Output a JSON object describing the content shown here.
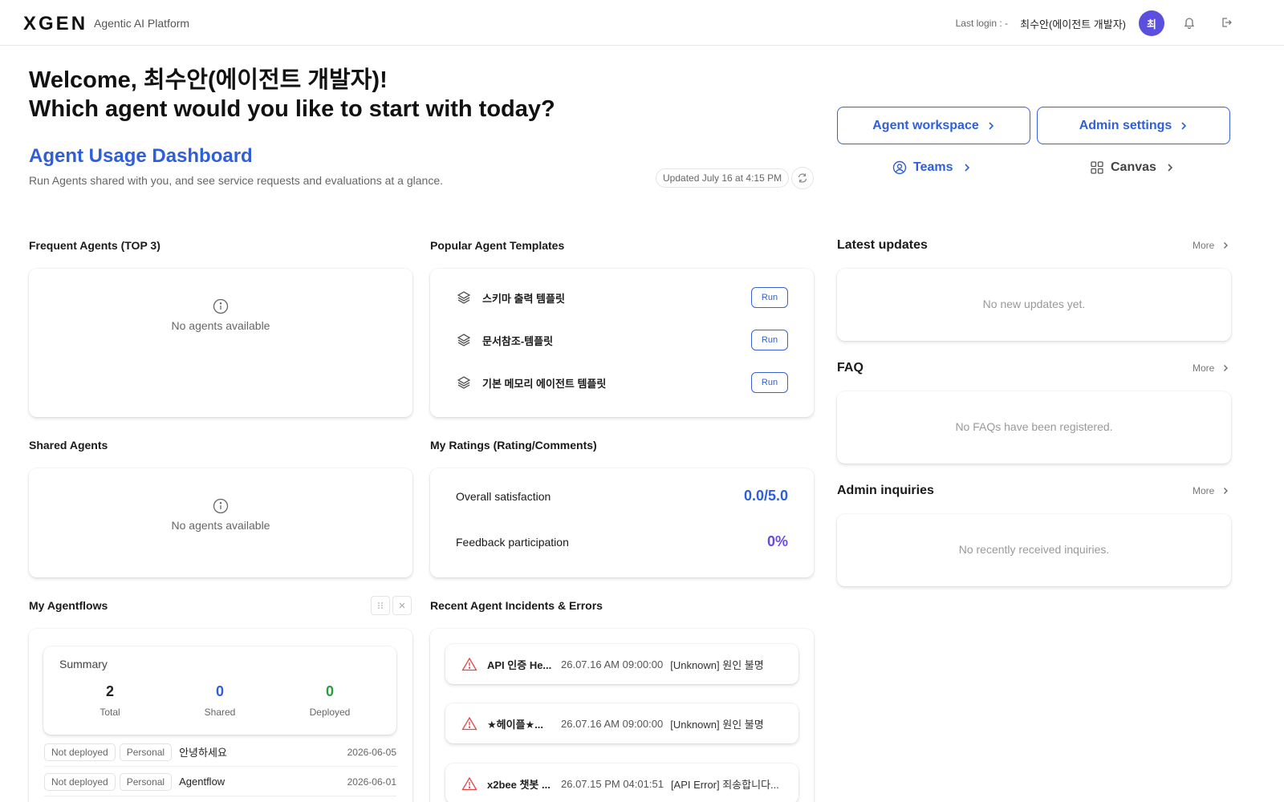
{
  "header": {
    "logo": "GEN",
    "logo_mark": "X",
    "platform": "Agentic AI Platform",
    "last_login": "Last login : -",
    "username": "최수안(에이전트 개발자)",
    "avatar": "최"
  },
  "welcome": {
    "line1": "Welcome, 최수안(에이전트 개발자)!",
    "line2": "Which agent would you like to start with today?"
  },
  "dashboard": {
    "title": "Agent Usage Dashboard",
    "subtitle": "Run Agents shared with you, and see service requests and evaluations at a glance.",
    "updated": "Updated July 16 at 4:15 PM"
  },
  "nav": {
    "agent_workspace": "Agent workspace",
    "admin_settings": "Admin settings",
    "teams": "Teams",
    "canvas": "Canvas"
  },
  "frequent": {
    "title": "Frequent Agents (TOP 3)",
    "empty": "No agents available"
  },
  "shared": {
    "title": "Shared Agents",
    "empty": "No agents available"
  },
  "templates": {
    "title": "Popular Agent Templates",
    "run_label": "Run",
    "items": [
      {
        "name": "스키마 출력 템플릿"
      },
      {
        "name": "문서참조-템플릿"
      },
      {
        "name": "기본 메모리 에이전트 템플릿"
      }
    ]
  },
  "ratings": {
    "title": "My Ratings (Rating/Comments)",
    "satisfaction_label": "Overall satisfaction",
    "satisfaction_value": "0.0/5.0",
    "participation_label": "Feedback participation",
    "participation_value": "0%"
  },
  "agentflows": {
    "title": "My Agentflows",
    "summary_title": "Summary",
    "total": "2",
    "total_label": "Total",
    "shared": "0",
    "shared_label": "Shared",
    "deployed": "0",
    "deployed_label": "Deployed",
    "rows": [
      {
        "status": "Not deployed",
        "scope": "Personal",
        "name": "안녕하세요",
        "date": "2026-06-05"
      },
      {
        "status": "Not deployed",
        "scope": "Personal",
        "name": "Agentflow",
        "date": "2026-06-01"
      }
    ]
  },
  "incidents": {
    "title": "Recent Agent Incidents & Errors",
    "items": [
      {
        "title": "API 인증 He...",
        "time": "26.07.16 AM 09:00:00",
        "msg": "[Unknown] 원인 불명"
      },
      {
        "title": "★헤이플★...",
        "time": "26.07.16 AM 09:00:00",
        "msg": "[Unknown] 원인 불명"
      },
      {
        "title": "x2bee 챗봇 ...",
        "time": "26.07.15 PM 04:01:51",
        "msg": "[API Error] 죄송합니다..."
      }
    ]
  },
  "latest": {
    "title": "Latest updates",
    "more": "More",
    "empty": "No new updates yet."
  },
  "faq": {
    "title": "FAQ",
    "more": "More",
    "empty": "No FAQs have been registered."
  },
  "inquiries": {
    "title": "Admin inquiries",
    "more": "More",
    "empty": "No recently received inquiries."
  },
  "colors": {
    "accent": "#2f5fd8",
    "purple": "#6a4be0",
    "avatar": "#5b4fe0",
    "deployed": "#2a9d3a",
    "warning": "#e04848"
  }
}
